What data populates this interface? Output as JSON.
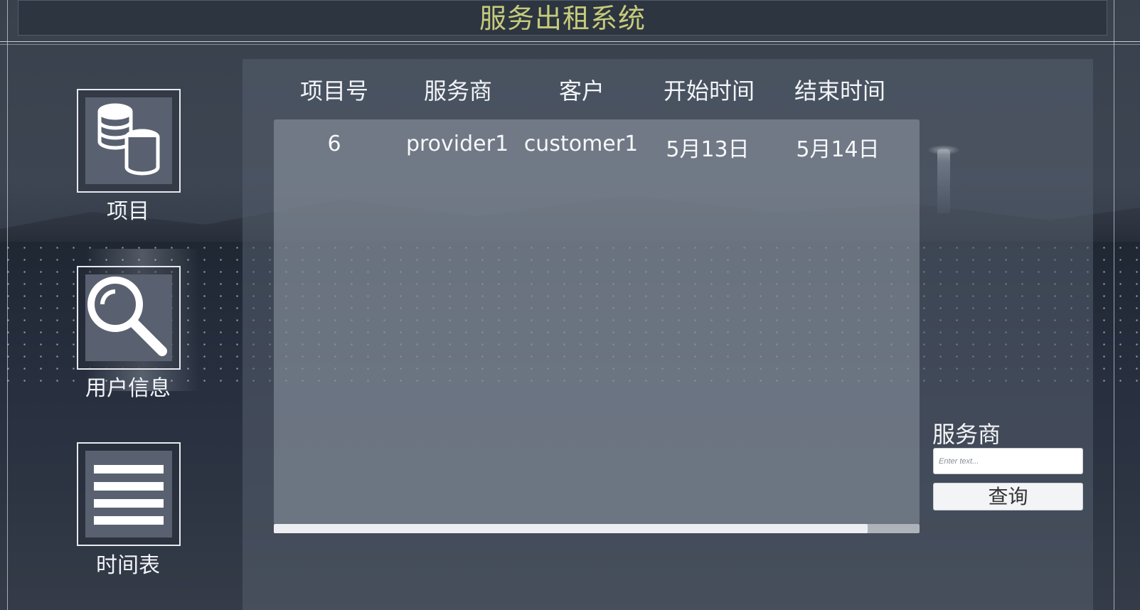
{
  "header": {
    "title": "服务出租系统"
  },
  "sidebar": {
    "items": [
      {
        "label": "项目",
        "icon": "database-icon"
      },
      {
        "label": "用户信息",
        "icon": "search-icon"
      },
      {
        "label": "时间表",
        "icon": "list-icon"
      }
    ]
  },
  "table": {
    "columns": [
      "项目号",
      "服务商",
      "客户",
      "开始时间",
      "结束时间"
    ],
    "rows": [
      [
        "6",
        "provider1",
        "customer1",
        "5月13日",
        "5月14日"
      ]
    ],
    "scroll_fraction": 0.92
  },
  "filter": {
    "label": "服务商",
    "input_placeholder": "Enter text...",
    "input_value": "",
    "button_label": "查询"
  },
  "colors": {
    "title": "#c6cb7a",
    "panel": "#565f6e",
    "text": "#f2f4f7"
  }
}
